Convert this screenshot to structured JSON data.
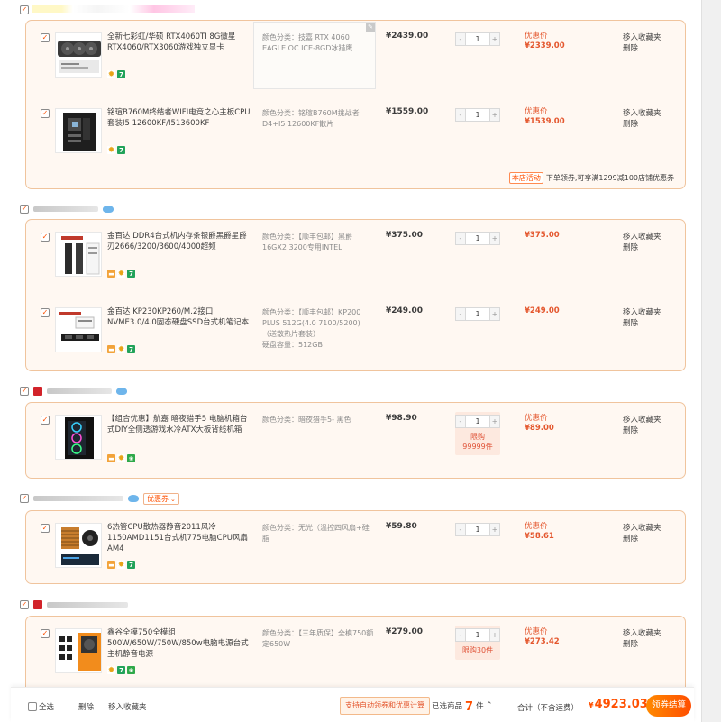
{
  "shops": [
    {
      "id": "s1",
      "items": [
        {
          "title": "全新七彩虹/华硕 RTX4060TI 8G微星RTX4060/RTX3060游戏独立显卡",
          "sku": "颜色分类：技嘉 RTX 4060 EAGLE OC ICE-8GD冰猎鹰",
          "price": "¥2439.00",
          "qty": "1",
          "disc_label": "优惠价",
          "disc_price": "¥2339.00",
          "fav": "移入收藏夹",
          "del": "删除"
        },
        {
          "title": "铭瑄B760M终结者WIFI电竞之心主板CPU套装I5 12600KF/I513600KF",
          "sku": "颜色分类：铭瑄B760M挑战者D4+I5 12600KF散片",
          "price": "¥1559.00",
          "qty": "1",
          "disc_label": "优惠价",
          "disc_price": "¥1539.00",
          "fav": "移入收藏夹",
          "del": "删除"
        }
      ],
      "promo_tag": "本店活动",
      "promo_text": "下单领券,可享满1299减100店铺优惠券"
    },
    {
      "id": "s2",
      "items": [
        {
          "title": "金百达 DDR4台式机内存条银爵黑爵星爵刃2666/3200/3600/4000超频",
          "sku": "颜色分类：【顺丰包邮】黑爵16GX2 3200专用INTEL",
          "price": "¥375.00",
          "qty": "1",
          "disc_label": "",
          "disc_price": "¥375.00",
          "fav": "移入收藏夹",
          "del": "删除"
        },
        {
          "title": "金百达 KP230KP260/M.2接口NVME3.0/4.0固态硬盘SSD台式机笔记本",
          "sku": "颜色分类：【顺丰包邮】KP200 PLUS 512G(4.0 7100/5200)（送散热片套装）",
          "sku2": "硬盘容量：512GB",
          "price": "¥249.00",
          "qty": "1",
          "disc_label": "",
          "disc_price": "¥249.00",
          "fav": "移入收藏夹",
          "del": "删除"
        }
      ]
    },
    {
      "id": "s3",
      "items": [
        {
          "title": "【组合优惠】航嘉 暗夜猎手5 电脑机箱台式DIY全侧透游戏水冷ATX大板背线机箱",
          "sku": "颜色分类：暗夜猎手5- 黑色",
          "price": "¥98.90",
          "qty": "1",
          "limit": "限购",
          "limit2": "99999件",
          "disc_label": "优惠价",
          "disc_price": "¥89.00",
          "fav": "移入收藏夹",
          "del": "删除"
        }
      ]
    },
    {
      "id": "s4",
      "coupon": "优惠券",
      "items": [
        {
          "title": "6热管CPU散热器静音2011风冷1150AMD1151台式机775电脑CPU风扇AM4",
          "sku": "颜色分类：无光（温控四风扇+硅脂",
          "price": "¥59.80",
          "qty": "1",
          "disc_label": "优惠价",
          "disc_price": "¥58.61",
          "fav": "移入收藏夹",
          "del": "删除"
        }
      ]
    },
    {
      "id": "s5",
      "items": [
        {
          "title": "鑫谷全模750全模组500W/650W/750W/850w电脑电源台式主机静音电源",
          "sku": "颜色分类：【三年质保】全模750额定650W",
          "price": "¥279.00",
          "qty": "1",
          "limit": "限购30件",
          "disc_label": "优惠价",
          "disc_price": "¥273.42",
          "fav": "移入收藏夹",
          "del": "删除"
        }
      ]
    }
  ],
  "footer": {
    "select_all": "全选",
    "delete": "删除",
    "move_fav": "移入收藏夹",
    "auto_coupon": "支持自动领券和优惠计算",
    "selected_prefix": "已选商品",
    "selected_count": "7",
    "selected_suffix": "件",
    "total_label": "合计（不含运费）:",
    "total_currency": "¥",
    "total_value": "4923.03",
    "checkout": "领券结算"
  },
  "colors": {
    "accent": "#ff5000",
    "discount": "#e4572e",
    "box_border": "#f0c49d",
    "box_bg": "#fff8f2"
  }
}
